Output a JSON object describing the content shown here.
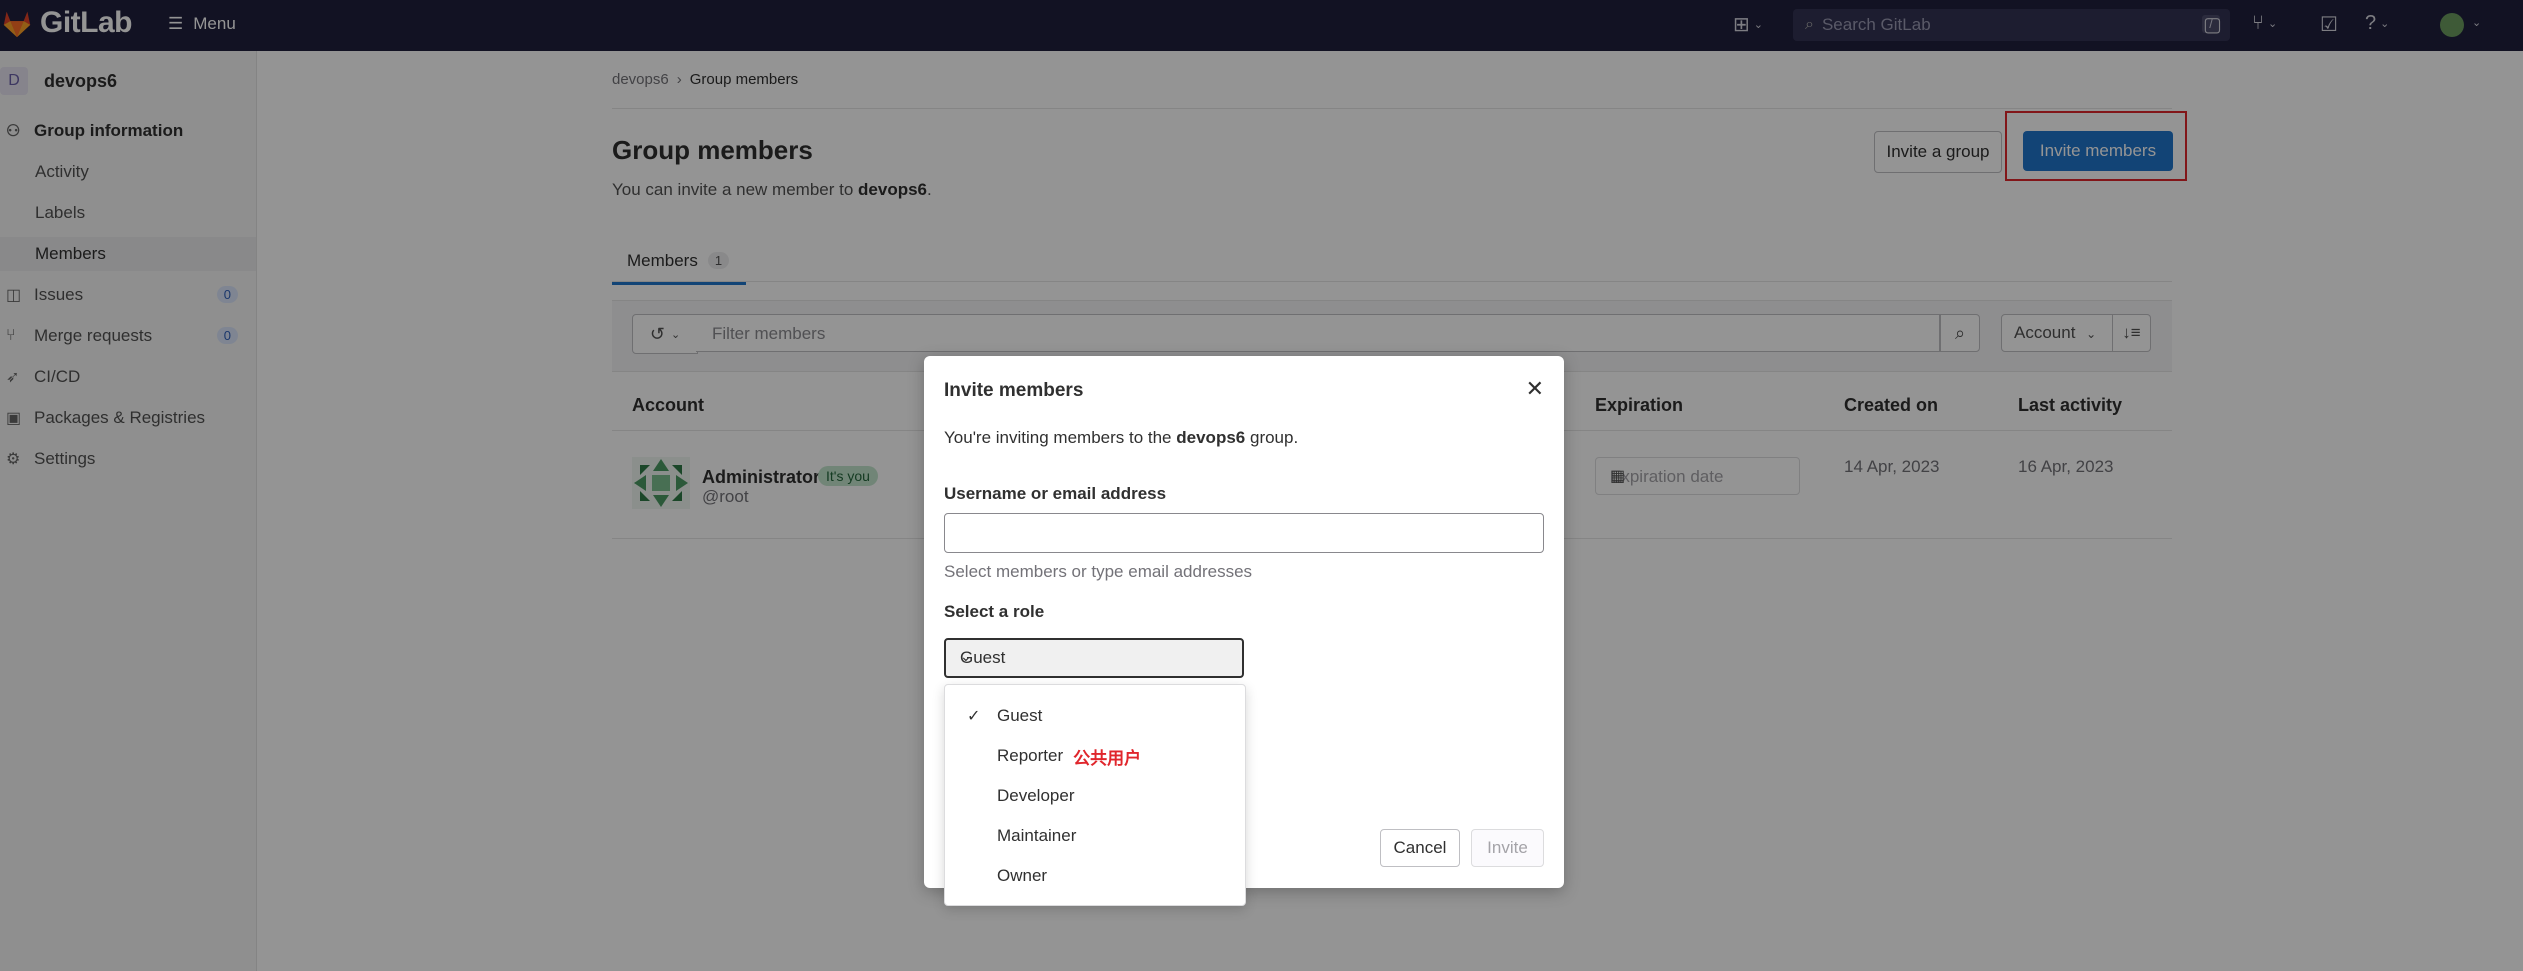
{
  "navbar": {
    "app_name": "GitLab",
    "menu_label": "Menu",
    "search_placeholder": "Search GitLab",
    "search_shortcut": "/"
  },
  "sidebar": {
    "group_avatar": "D",
    "group_name": "devops6",
    "items": [
      {
        "label": "Group information",
        "icon": "group-info-icon"
      },
      {
        "label": "Activity"
      },
      {
        "label": "Labels"
      },
      {
        "label": "Members"
      },
      {
        "label": "Issues",
        "icon": "issues-icon",
        "count": "0"
      },
      {
        "label": "Merge requests",
        "icon": "merge-request-icon",
        "count": "0"
      },
      {
        "label": "CI/CD",
        "icon": "rocket-icon"
      },
      {
        "label": "Packages & Registries",
        "icon": "package-icon"
      },
      {
        "label": "Settings",
        "icon": "gear-icon"
      }
    ]
  },
  "breadcrumb": {
    "parent": "devops6",
    "current": "Group members"
  },
  "page": {
    "title": "Group members",
    "subtitle_prefix": "You can invite a new member to",
    "subtitle_group": "devops6",
    "subtitle_suffix": ".",
    "invite_group_label": "Invite a group",
    "invite_members_label": "Invite members"
  },
  "tabs": [
    {
      "label": "Members",
      "count": "1"
    }
  ],
  "filter": {
    "placeholder": "Filter members",
    "sort_label": "Account"
  },
  "table": {
    "headers": [
      "Account",
      "Expiration",
      "Created on",
      "Last activity"
    ],
    "rows": [
      {
        "name": "Administrator",
        "badge": "It's you",
        "handle": "@root",
        "expiration_placeholder": "Expiration date",
        "created_on": "14 Apr, 2023",
        "last_activity": "16 Apr, 2023"
      }
    ]
  },
  "modal": {
    "title": "Invite members",
    "intro_prefix": "You're inviting members to the",
    "intro_group": "devops6",
    "intro_suffix": "group.",
    "username_label": "Username or email address",
    "username_value": "",
    "username_help": "Select members or type email addresses",
    "role_label": "Select a role",
    "role_selected": "Guest",
    "role_options": [
      {
        "label": "Guest",
        "checked": true,
        "note": ""
      },
      {
        "label": "Reporter",
        "checked": false,
        "note": "公共用户"
      },
      {
        "label": "Developer",
        "checked": false,
        "note": ""
      },
      {
        "label": "Maintainer",
        "checked": false,
        "note": ""
      },
      {
        "label": "Owner",
        "checked": false,
        "note": ""
      }
    ],
    "cancel_label": "Cancel",
    "invite_label": "Invite"
  },
  "colors": {
    "navbar": "#1f1f3d",
    "primary": "#1f75cb",
    "annotation_red": "#e0262c"
  }
}
